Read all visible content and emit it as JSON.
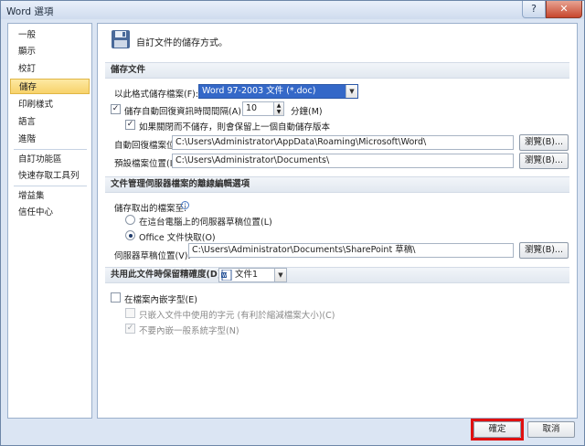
{
  "window": {
    "title": "Word 選項",
    "help_glyph": "?",
    "close_glyph": "✕"
  },
  "sidebar": {
    "items": [
      {
        "label": "一般",
        "active": false
      },
      {
        "label": "顯示",
        "active": false
      },
      {
        "label": "校訂",
        "active": false
      },
      {
        "label": "儲存",
        "active": true
      },
      {
        "label": "印刷樣式",
        "active": false
      },
      {
        "label": "語言",
        "active": false
      },
      {
        "label": "進階",
        "active": false
      },
      {
        "label": "自訂功能區",
        "active": false
      },
      {
        "label": "快速存取工具列",
        "active": false
      },
      {
        "label": "增益集",
        "active": false
      },
      {
        "label": "信任中心",
        "active": false
      }
    ]
  },
  "header": {
    "title": "自訂文件的儲存方式。",
    "icon": "floppy-disk-icon"
  },
  "save_docs": {
    "section": "儲存文件",
    "format_label": "以此格式儲存檔案(F):",
    "format_value": "Word 97-2003 文件 (*.doc)",
    "autorecover_label": "儲存自動回復資訊時間間隔(A):",
    "autorecover_checked": true,
    "autorecover_minutes": "10",
    "minutes_label": "分鐘(M)",
    "keep_last_label": "如果關閉而不儲存，則會保留上一個自動儲存版本",
    "keep_last_checked": true,
    "autorecover_loc_label": "自動回復檔案位置(R):",
    "autorecover_loc_value": "C:\\Users\\Administrator\\AppData\\Roaming\\Microsoft\\Word\\",
    "default_loc_label": "預設檔案位置(I):",
    "default_loc_value": "C:\\Users\\Administrator\\Documents\\",
    "browse_label": "瀏覽(B)..."
  },
  "server": {
    "section": "文件管理伺服器檔案的離線編輯選項",
    "save_to_label": "儲存取出的檔案至:",
    "opt_server_label": "在這台電腦上的伺服器草稿位置(L)",
    "opt_cache_label": "Office 文件快取(O)",
    "selected": "cache",
    "drafts_label": "伺服器草稿位置(V):",
    "drafts_value": "C:\\Users\\Administrator\\Documents\\SharePoint 草稿\\",
    "browse_label": "瀏覽(B)..."
  },
  "fidelity": {
    "section_label": "共用此文件時保留精確度(D):",
    "doc_value": "文件1",
    "doc_icon": "word-document-icon",
    "embed_fonts_label": "在檔案內嵌字型(E)",
    "embed_fonts_checked": false,
    "embed_used_label": "只嵌入文件中使用的字元 (有利於縮減檔案大小)(C)",
    "embed_used_checked": false,
    "no_common_label": "不要內嵌一般系統字型(N)",
    "no_common_checked": true
  },
  "footer": {
    "ok_label": "確定",
    "cancel_label": "取消",
    "ok_highlight_color": "#e01010"
  }
}
